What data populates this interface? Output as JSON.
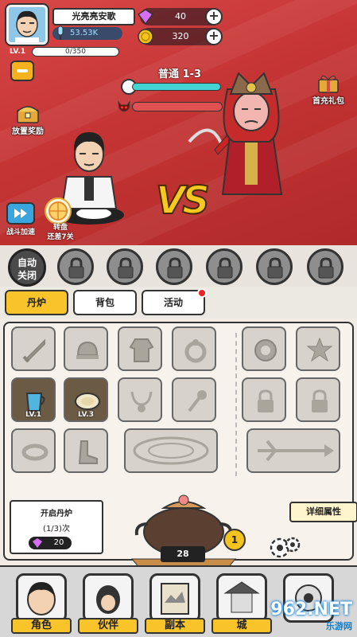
{
  "player": {
    "name": "光亮亮安歌",
    "power": "53.53K",
    "level_label": "LV.1",
    "exp": "0/350"
  },
  "resources": {
    "gems": "40",
    "coins": "320"
  },
  "battle": {
    "stage": "普通 1-3",
    "vs": "VS",
    "idle_reward": "放置奖励",
    "first_recharge": "首充礼包",
    "speed_up": "战斗加速",
    "wheel_line1": "转盘",
    "wheel_line2": "还差7关"
  },
  "skills": {
    "auto_line1": "自动",
    "auto_line2": "关闭"
  },
  "tabs": [
    {
      "label": "丹炉"
    },
    {
      "label": "背包"
    },
    {
      "label": "活动"
    }
  ],
  "inventory": {
    "cup_level": "LV.1",
    "plate_level": "LV.3"
  },
  "alchemy": {
    "title": "开启丹炉",
    "count": "(1/3)次",
    "cost": "20",
    "furnace_count": "28",
    "badge": "1",
    "detail_button": "详细属性"
  },
  "nav": [
    {
      "label": "角色"
    },
    {
      "label": "伙伴"
    },
    {
      "label": "副本"
    },
    {
      "label": "城"
    },
    {
      "label": ""
    }
  ],
  "watermark": {
    "main": "962.NET",
    "sub": "乐游网"
  },
  "colors": {
    "battle_bg": "#c93a3a",
    "tab_active": "#f8c42a",
    "timer": "#43d3d3",
    "enemy_hp": "#e25151",
    "vs": "#f5c91f"
  }
}
